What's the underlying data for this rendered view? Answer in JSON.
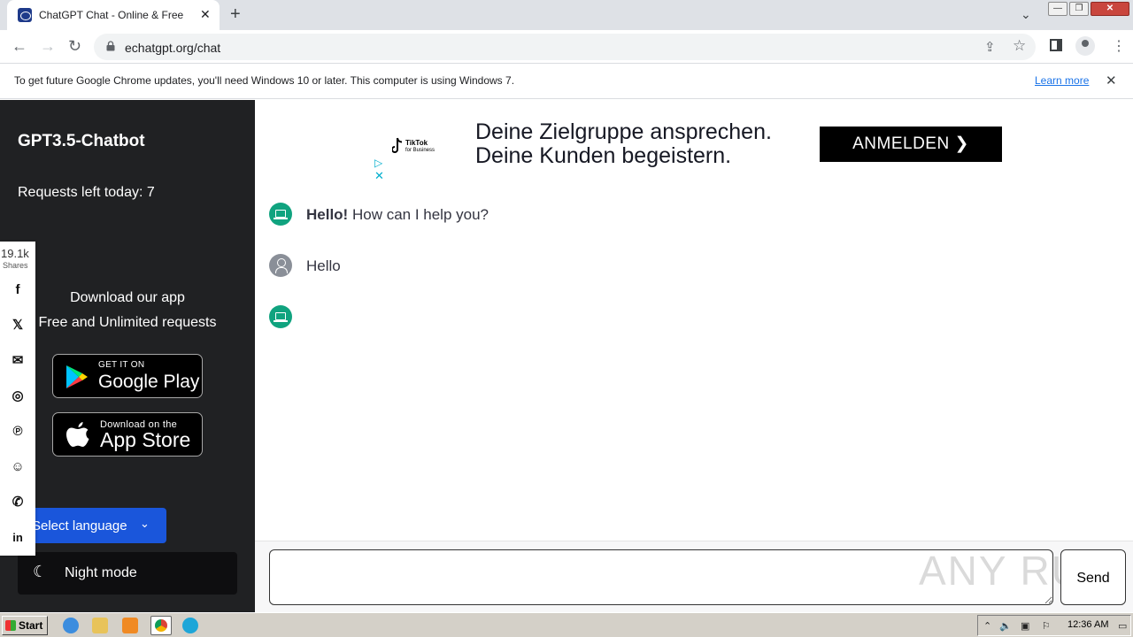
{
  "browser": {
    "tab_title": "ChatGPT Chat - Online & Free",
    "tab_close": "✕",
    "new_tab": "+",
    "url": "echatgpt.org/chat",
    "win_min": "—",
    "win_max": "❐",
    "win_close": "✕"
  },
  "infobar": {
    "message": "To get future Google Chrome updates, you'll need Windows 10 or later. This computer is using Windows 7.",
    "learn_more": "Learn more",
    "close": "✕"
  },
  "sidebar": {
    "brand": "GPT3.5-Chatbot",
    "requests": "Requests left today: 7",
    "app_heading_1": "Download our app",
    "app_heading_2": "Free and Unlimited requests",
    "google_play_small": "GET IT ON",
    "google_play_big": "Google Play",
    "app_store_small": "Download on the",
    "app_store_big": "App Store",
    "select_language": "Select language",
    "night_mode": "Night mode"
  },
  "share": {
    "count": "19.1k",
    "label": "Shares"
  },
  "ad": {
    "logo_line1": "TikTok",
    "logo_line2": "for Business",
    "line1": "Deine Zielgruppe ansprechen.",
    "line2": "Deine Kunden begeistern.",
    "cta": "ANMELDEN"
  },
  "chat": {
    "messages": [
      {
        "role": "bot",
        "bold": "Hello!",
        "text": " How can I help you?"
      },
      {
        "role": "user",
        "text": "Hello"
      },
      {
        "role": "bot",
        "text": ""
      }
    ],
    "send": "Send",
    "input_value": ""
  },
  "watermark": "ANY RUN",
  "taskbar": {
    "start": "Start",
    "clock": "12:36 AM"
  },
  "colors": {
    "sidebar_bg": "#202123",
    "bot_avatar": "#10a37f",
    "language_button": "#1a56db",
    "link": "#1a73e8"
  }
}
